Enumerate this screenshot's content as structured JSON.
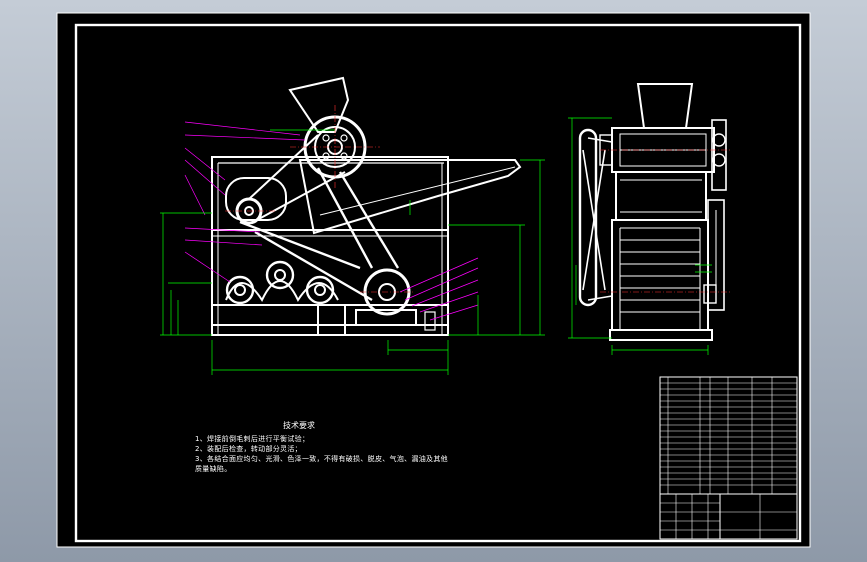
{
  "drawing": {
    "colors": {
      "background": "#000000",
      "frame": "#ffffff",
      "outline": "#ffffff",
      "dimension": "#00ff00",
      "leader": "#ff00ff",
      "centerline": "#ff3030",
      "page_top": "#c4ccd6",
      "page_bottom": "#8e99a8"
    },
    "tech_notes": {
      "title": "技术要求",
      "lines": [
        "1、焊接前倒毛刺后进行平衡试验；",
        "2、装配后检查，转动部分灵活；",
        "3、各结合面应均匀、光滑、色泽一致，不得有破损、脱皮、气泡、漏油及其他",
        "质量缺陷。"
      ]
    },
    "title_block": {
      "parts_rows": 17,
      "icon": "title-block-grid"
    }
  }
}
